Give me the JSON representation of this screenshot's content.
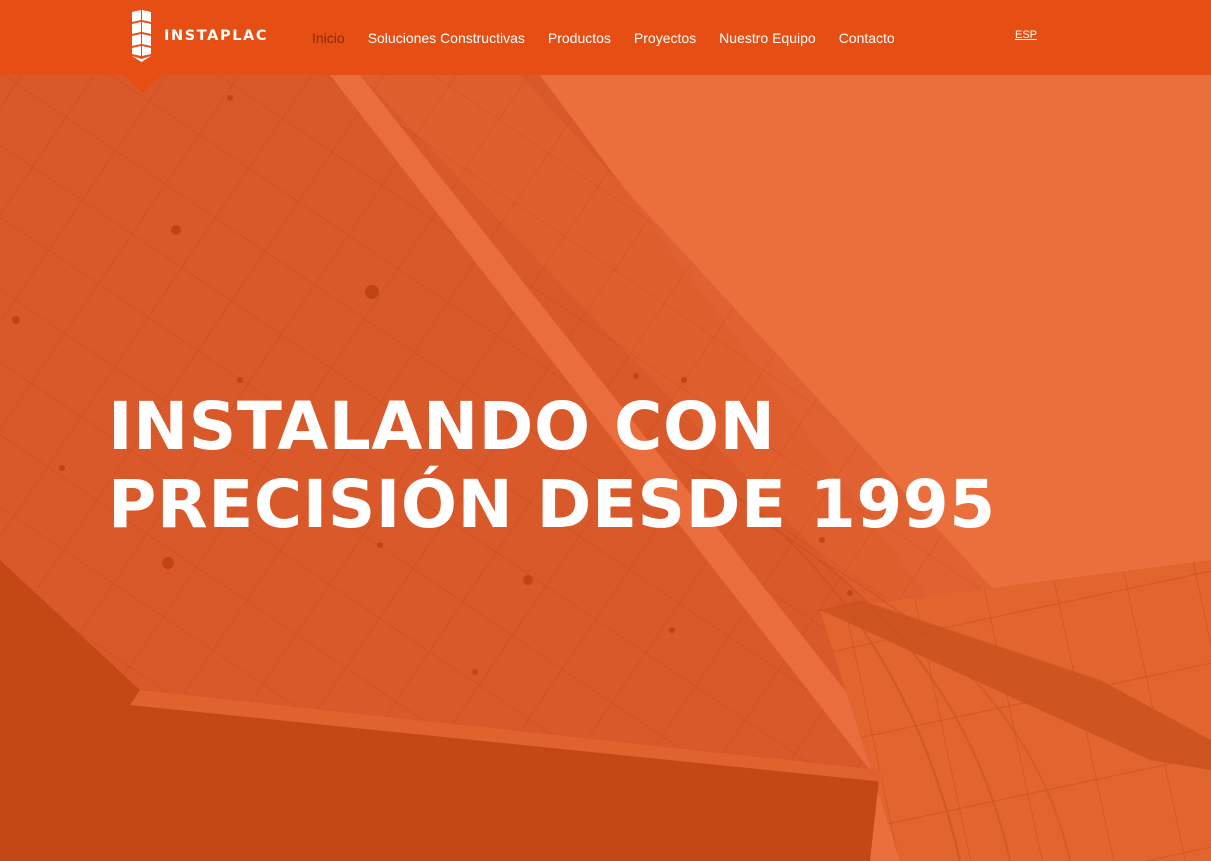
{
  "brand": {
    "name": "INSTAPLAC",
    "logo_icon": "instaplac-building-logo"
  },
  "nav": {
    "items": [
      {
        "label": "Inicio",
        "active": true
      },
      {
        "label": "Soluciones Constructivas",
        "active": false
      },
      {
        "label": "Productos",
        "active": false
      },
      {
        "label": "Proyectos",
        "active": false
      },
      {
        "label": "Nuestro Equipo",
        "active": false
      },
      {
        "label": "Contacto",
        "active": false
      }
    ]
  },
  "language": {
    "label": "ESP"
  },
  "hero": {
    "title_line1": "INSTALANDO CON",
    "title_line2": "PRECISIÓN DESDE 1995"
  },
  "colors": {
    "header": "#e64e13",
    "hero_overlay": "#e96c3b",
    "active_nav": "#8a2c09",
    "text": "#ffffff"
  }
}
